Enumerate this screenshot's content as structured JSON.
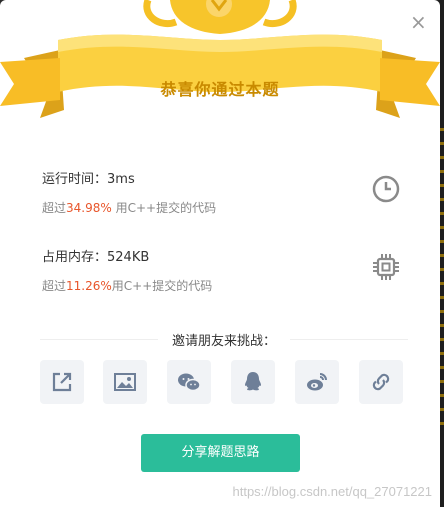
{
  "modal": {
    "close_glyph": "×",
    "title": "恭喜你通过本题"
  },
  "stats": {
    "runtime_label": "运行时间：",
    "runtime_value": "3ms",
    "runtime_prefix": "超过",
    "runtime_pct": "34.98%",
    "runtime_suffix": " 用C++提交的代码",
    "memory_label": "占用内存：",
    "memory_value": "524KB",
    "memory_prefix": "超过",
    "memory_pct": "11.26%",
    "memory_suffix": "用C++提交的代码"
  },
  "invite": {
    "label": "邀请朋友来挑战：",
    "share_icons": [
      "share-external-icon",
      "image-icon",
      "wechat-icon",
      "qq-icon",
      "weibo-icon",
      "link-icon"
    ]
  },
  "actions": {
    "primary": "分享解题思路"
  },
  "watermark": "https://blog.csdn.net/qq_27071221",
  "colors": {
    "accent": "#2bbd9a",
    "highlight": "#e8562b",
    "gold": "#f5c024"
  }
}
